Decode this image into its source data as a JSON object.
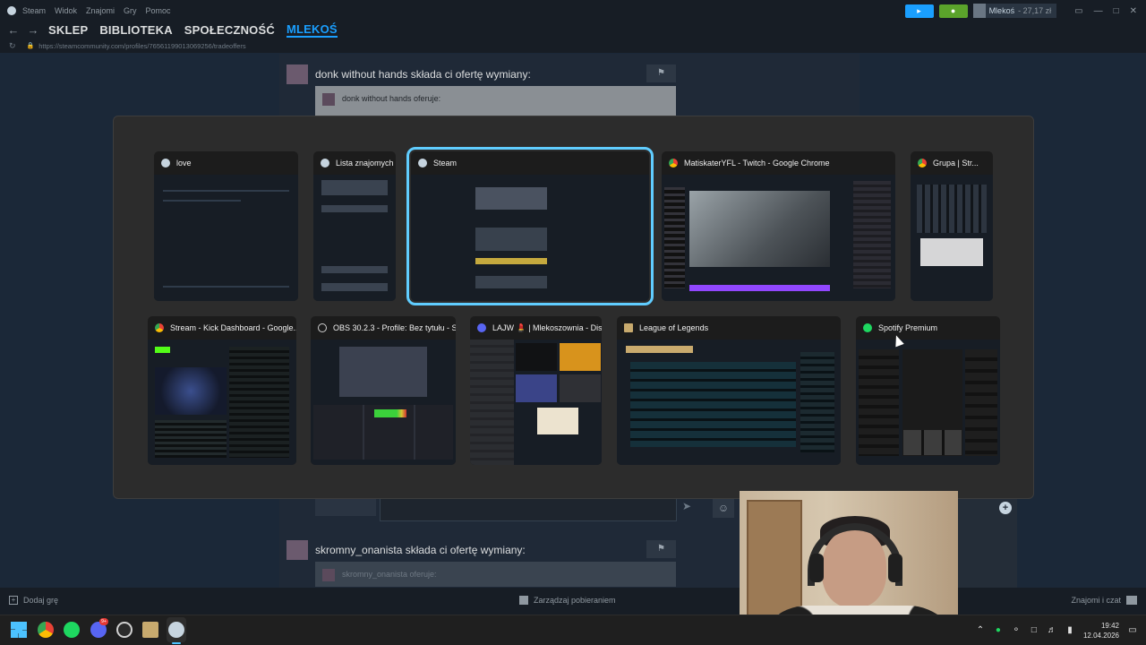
{
  "menubar": {
    "app_name": "Steam",
    "items": [
      "Widok",
      "Znajomi",
      "Gry",
      "Pomoc"
    ],
    "account_name": "Mlekoś",
    "balance": "27,17 zł",
    "announce_icon": "megaphone-icon",
    "notif_icon": "bell-icon"
  },
  "nav": {
    "links": [
      "SKLEP",
      "BIBLIOTEKA",
      "SPOŁECZNOŚĆ",
      "MLEKOŚ"
    ],
    "active": "MLEKOŚ",
    "url": "https://steamcommunity.com/profiles/76561199013069256/tradeoffers"
  },
  "page": {
    "offer1": {
      "header": "donk without hands składa ci ofertę wymiany:",
      "sub": "donk without hands oferuje:"
    },
    "offer2": {
      "header": "skromny_onanista składa ci ofertę wymiany:",
      "sub": "skromny_onanista oferuje:"
    }
  },
  "bottombar": {
    "add_game": "Dodaj grę",
    "downloads": "Zarządzaj pobieraniem",
    "friends": "Znajomi i czat"
  },
  "switcher": {
    "windows": [
      {
        "title": "love",
        "icon": "steam-icon"
      },
      {
        "title": "Lista znajomych",
        "icon": "steam-icon"
      },
      {
        "title": "Steam",
        "icon": "steam-icon",
        "selected": true
      },
      {
        "title": "MatiskaterYFL - Twitch - Google Chrome",
        "icon": "chrome-icon"
      },
      {
        "title": "Grupa | Str...",
        "icon": "chrome-icon"
      },
      {
        "title": "Stream - Kick Dashboard - Google...",
        "icon": "chrome-icon"
      },
      {
        "title": "OBS 30.2.3 - Profile: Bez tytułu - S...",
        "icon": "obs-icon"
      },
      {
        "title": "LAJW 💄 | Mlekoszownia - Dis...",
        "icon": "discord-icon"
      },
      {
        "title": "League of Legends",
        "icon": "lol-icon"
      },
      {
        "title": "Spotify Premium",
        "icon": "spotify-icon"
      }
    ]
  },
  "taskbar": {
    "apps": [
      "start-icon",
      "chrome-icon",
      "spotify-icon",
      "discord-icon",
      "obs-icon",
      "lol-icon",
      "steam-icon"
    ],
    "discord_badge": "9+",
    "time": "19:42",
    "date": "12.04.2026"
  },
  "colors": {
    "steam_blue": "#1a9fff",
    "selected_outline": "#60cdff",
    "notif_green": "#5ba32b"
  }
}
